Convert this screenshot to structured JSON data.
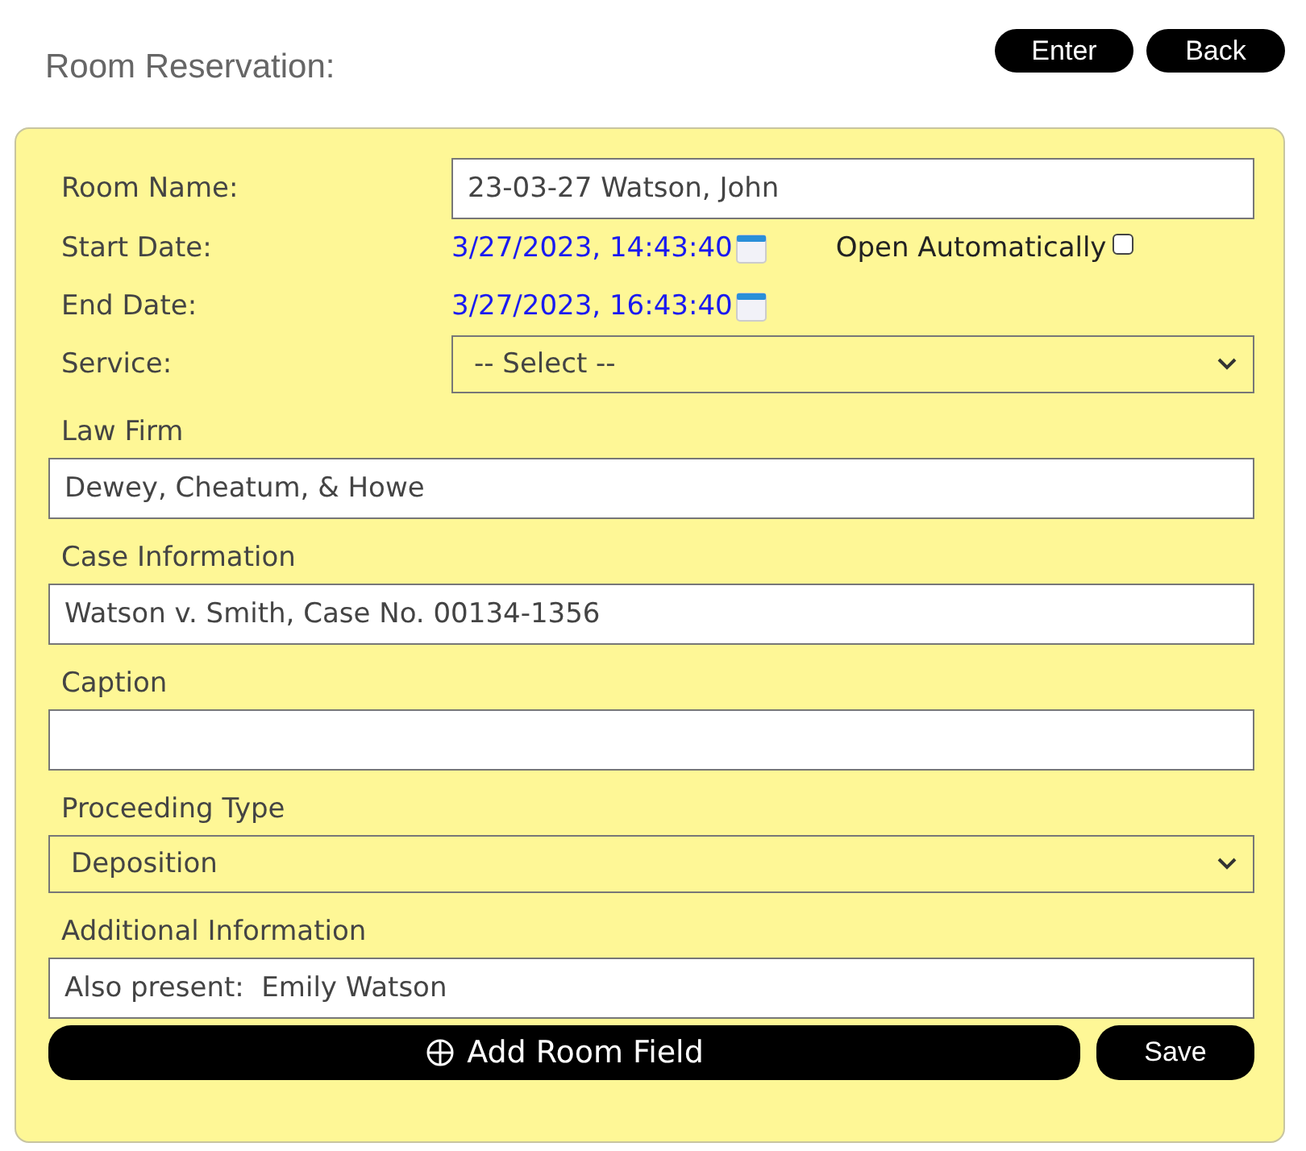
{
  "header": {
    "title": "Room Reservation:",
    "buttons": [
      "Enter",
      "Back"
    ]
  },
  "room_name": {
    "label": "Room Name:",
    "value": "23-03-27 Watson, John"
  },
  "start_date": {
    "label": "Start Date:",
    "value": "3/27/2023, 14:43:40",
    "auto_open": {
      "label": "Open Automatically",
      "checked": false
    }
  },
  "end_date": {
    "label": "End Date:",
    "value": "3/27/2023, 16:43:40"
  },
  "service": {
    "label": "Service:",
    "value": "-- Select --"
  },
  "fields": [
    {
      "kind": "text",
      "label": "Law Firm",
      "value": "Dewey, Cheatum, & Howe"
    },
    {
      "kind": "text",
      "label": "Case Information",
      "value": "Watson v. Smith, Case No. 00134-1356"
    },
    {
      "kind": "text",
      "label": "Caption"
    },
    {
      "kind": "select",
      "label": "Proceeding Type",
      "value": "Deposition"
    },
    {
      "kind": "text",
      "label": "Additional Information",
      "value": "Also present:  Emily Watson"
    }
  ],
  "actions": {
    "add": "Add Room Field",
    "save": "Save"
  }
}
